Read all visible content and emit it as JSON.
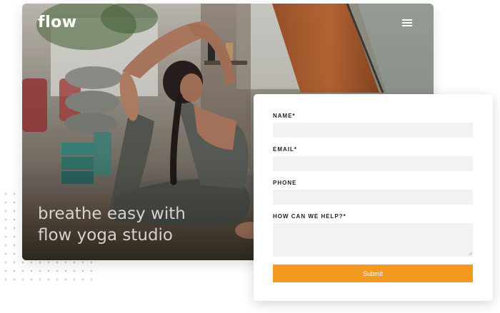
{
  "brand": {
    "logo_text": "flow"
  },
  "header": {
    "menu_icon": "hamburger-menu-icon"
  },
  "hero": {
    "tagline_line1": "breathe easy with",
    "tagline_line2": "flow yoga studio"
  },
  "form": {
    "name_label": "NAME*",
    "email_label": "EMAIL*",
    "phone_label": "PHONE",
    "help_label": "HOW CAN WE HELP?*",
    "name_value": "",
    "email_value": "",
    "phone_value": "",
    "help_value": "",
    "submit_label": "Submit"
  },
  "colors": {
    "accent": "#f49a20",
    "field_background": "#f2f2f2",
    "label_text": "#222222"
  }
}
